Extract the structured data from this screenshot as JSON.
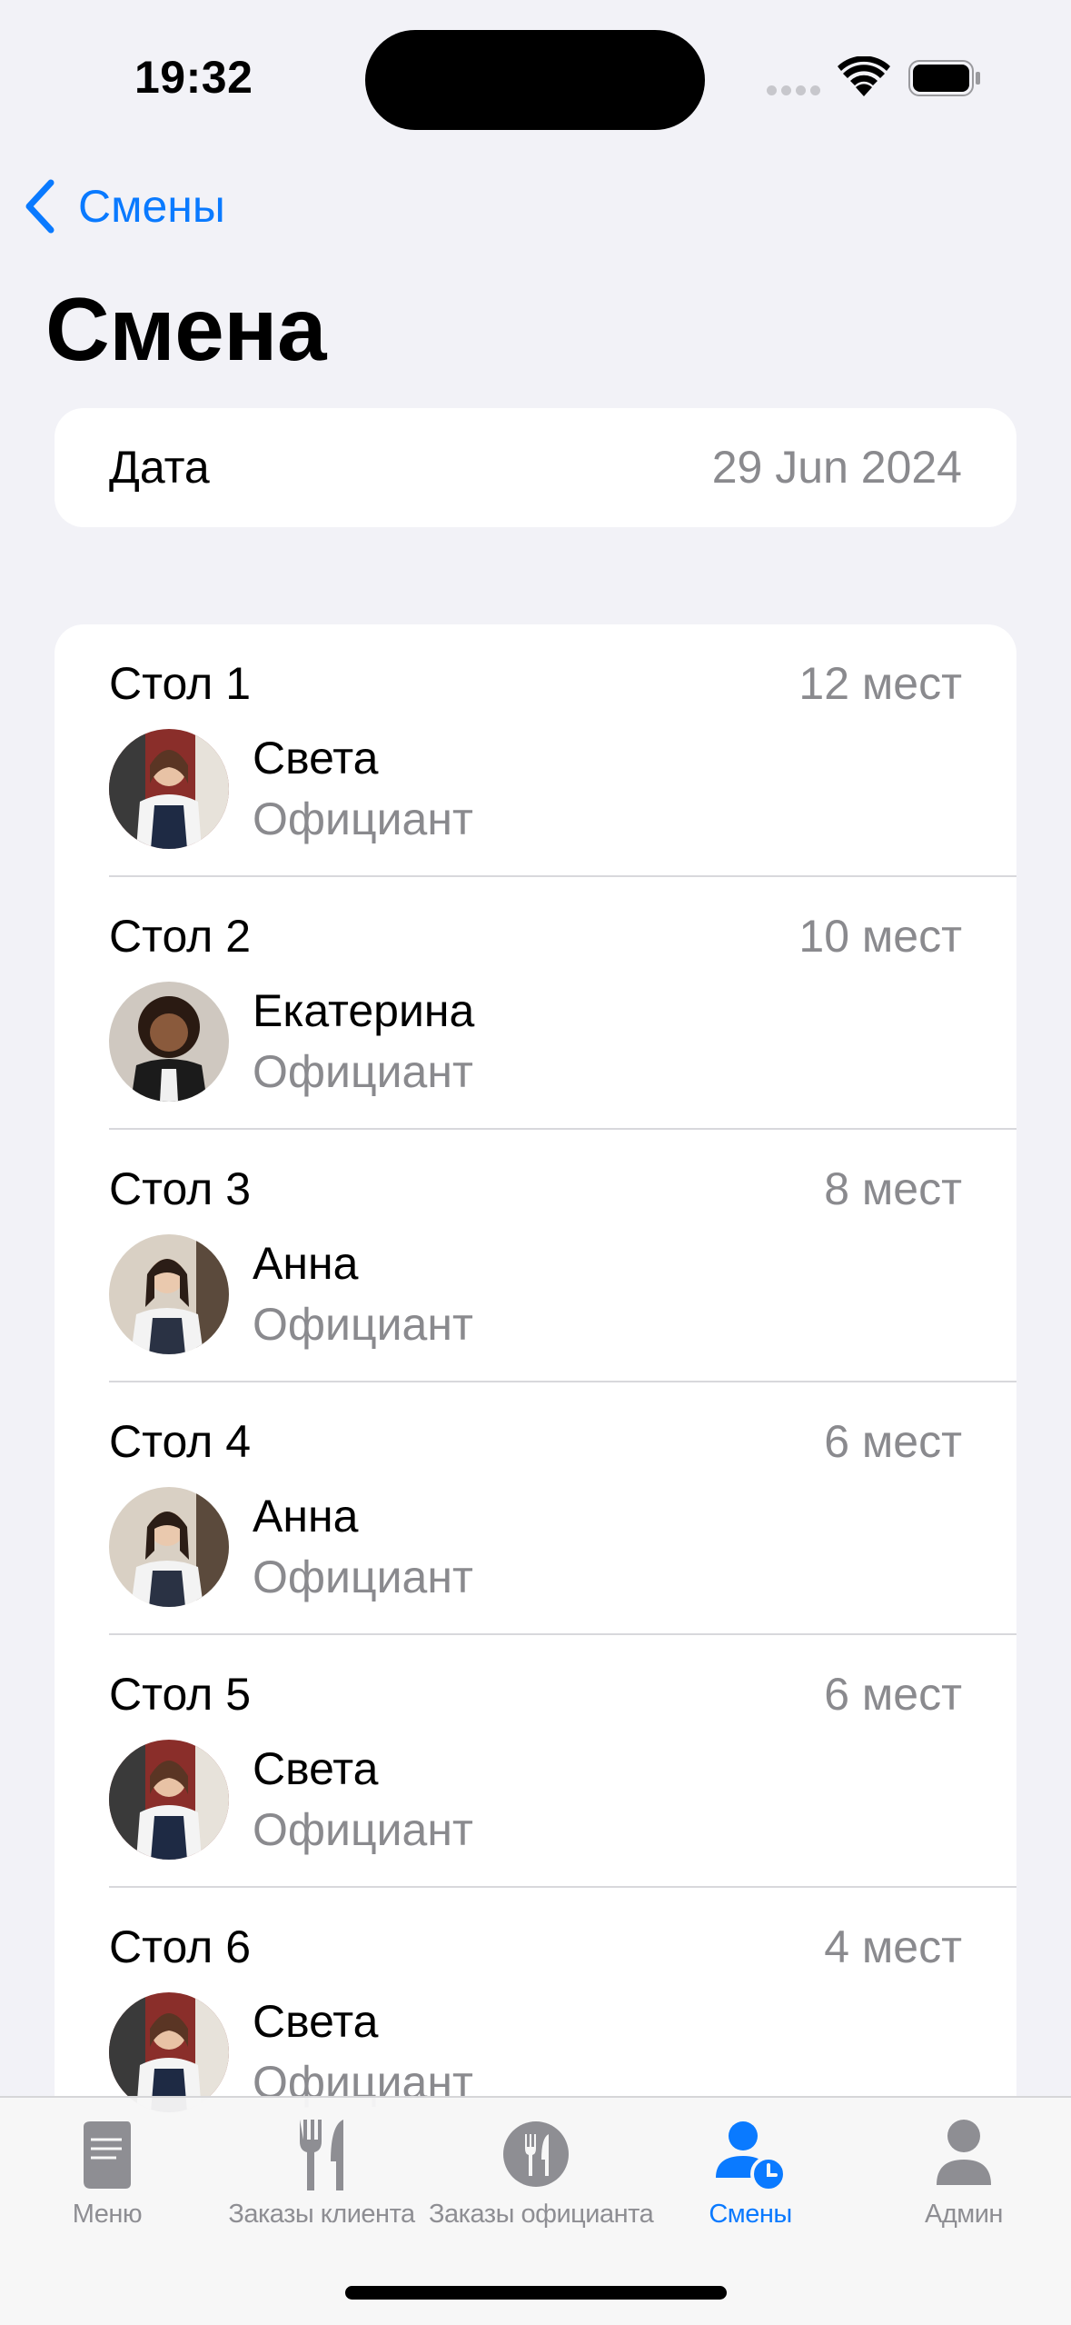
{
  "status_bar": {
    "time": "19:32"
  },
  "nav": {
    "back_label": "Смены",
    "title": "Смена"
  },
  "date_row": {
    "label": "Дата",
    "value": "29 Jun 2024"
  },
  "tables": [
    {
      "title": "Стол 1",
      "seats": "12 мест",
      "name": "Света",
      "role": "Официант"
    },
    {
      "title": "Стол 2",
      "seats": "10 мест",
      "name": "Екатерина",
      "role": "Официант"
    },
    {
      "title": "Стол 3",
      "seats": "8 мест",
      "name": "Анна",
      "role": "Официант"
    },
    {
      "title": "Стол 4",
      "seats": "6 мест",
      "name": "Анна",
      "role": "Официант"
    },
    {
      "title": "Стол 5",
      "seats": "6 мест",
      "name": "Света",
      "role": "Официант"
    },
    {
      "title": "Стол 6",
      "seats": "4 мест",
      "name": "Света",
      "role": "Официант"
    }
  ],
  "tabbar": {
    "items": [
      {
        "label": "Меню",
        "icon": "book-icon",
        "active": false
      },
      {
        "label": "Заказы клиента",
        "icon": "fork-knife-icon",
        "active": false
      },
      {
        "label": "Заказы официанта",
        "icon": "fork-knife-circle-icon",
        "active": false
      },
      {
        "label": "Смены",
        "icon": "person-clock-icon",
        "active": true
      },
      {
        "label": "Админ",
        "icon": "person-icon",
        "active": false
      }
    ]
  },
  "colors": {
    "accent": "#0a7aff",
    "secondary_text": "#8a8a8e",
    "background": "#f2f2f7"
  }
}
